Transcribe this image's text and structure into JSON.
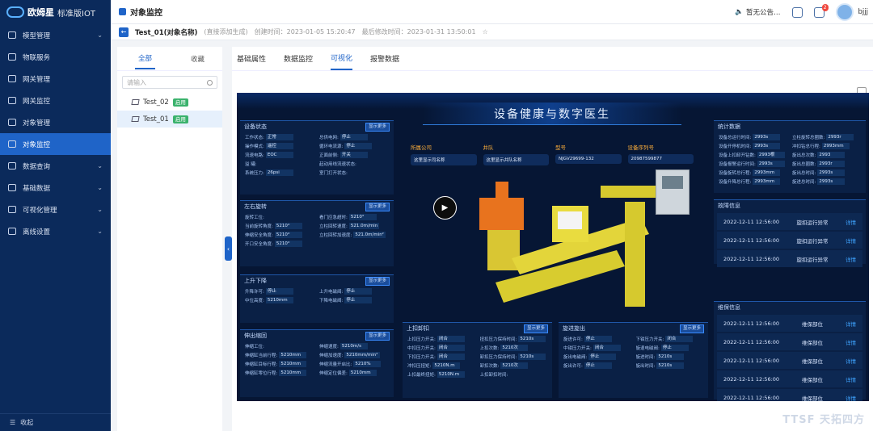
{
  "app": {
    "brand": "欧姆星",
    "edition": "标准版IOT"
  },
  "sidebar": {
    "items": [
      {
        "label": "模型管理",
        "chevron": true
      },
      {
        "label": "物联服务",
        "chevron": false
      },
      {
        "label": "网关管理",
        "chevron": false
      },
      {
        "label": "网关监控",
        "chevron": false
      },
      {
        "label": "对象管理",
        "chevron": false
      },
      {
        "label": "对象监控",
        "chevron": false,
        "active": true
      },
      {
        "label": "数据查询",
        "chevron": true
      },
      {
        "label": "基础数据",
        "chevron": true
      },
      {
        "label": "可视化管理",
        "chevron": true
      },
      {
        "label": "离线设置",
        "chevron": true
      }
    ],
    "collapse_label": "收起"
  },
  "header": {
    "title": "对象监控",
    "notice": "暂无公告…",
    "notif_count": "2",
    "user": "bjjj"
  },
  "subbar": {
    "object": "Test_01(对象名称)",
    "note": "(直接添加生成)",
    "created": "创建时间：2023-01-05 15:20:47",
    "modified": "最后修改时间：2023-01-31 13:50:01"
  },
  "left": {
    "tabs": [
      "全部",
      "收藏"
    ],
    "search_placeholder": "请输入",
    "items": [
      {
        "name": "Test_02",
        "tag": "启用"
      },
      {
        "name": "Test_01",
        "tag": "启用",
        "selected": true
      }
    ]
  },
  "main": {
    "tabs": [
      "基础属性",
      "数据监控",
      "可视化",
      "报警数据"
    ],
    "active_tab": "可视化"
  },
  "dashboard": {
    "title": "设备健康与数字医生",
    "more": "显示更多",
    "device_status": {
      "title": "设备状态",
      "kv": [
        [
          "工作状态:",
          "正常"
        ],
        [
          "总供电网:",
          "停止"
        ],
        [
          "操作模式:",
          "遥控"
        ],
        [
          "循环电流源:",
          "停止"
        ],
        [
          "流速电路:",
          "EOC"
        ],
        [
          "正面前侧:",
          "开关"
        ],
        [
          "溢 罐:",
          ""
        ],
        [
          "起动用线流速状态:",
          ""
        ],
        [
          "系统压力:",
          "26psi"
        ],
        [
          "室门打开状态:",
          ""
        ]
      ]
    },
    "left_rot": {
      "title": "左右旋转",
      "kv": [
        [
          "旋转工位:",
          ""
        ],
        [
          "看门应急超时:",
          "5210°"
        ],
        [
          "当前旋转角度:",
          "5210°"
        ],
        [
          "立柱回转速度:",
          "521.0m/min"
        ],
        [
          "伸缩安全角度:",
          "5210°"
        ],
        [
          "立柱回转加速度:",
          "521.0m/min²"
        ],
        [
          "开口安全角度:",
          "5210°"
        ],
        [
          "",
          ""
        ]
      ]
    },
    "lift": {
      "title": "上升下降",
      "kv": [
        [
          "升降许可:",
          "停止"
        ],
        [
          "上升电磁阀:",
          "停止"
        ],
        [
          "中位高度:",
          "5210mm"
        ],
        [
          "下降电磁阀:",
          "停止"
        ]
      ]
    },
    "extend": {
      "title": "伸出缩回",
      "kv": [
        [
          "伸缩工位:",
          ""
        ],
        [
          "伸缩速度:",
          "5210m/s"
        ],
        [
          "伸缩缸当前行程:",
          "5210mm"
        ],
        [
          "伸缩加速度:",
          "5210mm/min²"
        ],
        [
          "伸缩缸目标行程:",
          "5210mm"
        ],
        [
          "伸缩流量开启比:",
          "5210%"
        ],
        [
          "伸缩缸零位行程:",
          "5210mm"
        ],
        [
          "伸缩定位偏差:",
          "5210mm"
        ]
      ]
    },
    "cards": [
      {
        "title": "所属公司",
        "value": "这里显示司名称"
      },
      {
        "title": "井队",
        "value": "这里显示井队名称"
      },
      {
        "title": "型号",
        "value": "NJGV29699-132"
      },
      {
        "title": "设备序列号",
        "value": "20987599877"
      }
    ],
    "clamp": {
      "title": "上扣卸扣",
      "kv": [
        [
          "上扣压力开关:",
          "闭合"
        ],
        [
          "扭扣压力保持时间:",
          "5210s"
        ],
        [
          "中扣压力开关:",
          "闭合"
        ],
        [
          "上扣次数:",
          "5210次"
        ],
        [
          "下扣压力开关:",
          "闭合"
        ],
        [
          "卸扣压力保持时间:",
          "5210s"
        ],
        [
          "冲扣压扭矩:",
          "5210N.m"
        ],
        [
          "卸扣次数:",
          "5210次"
        ],
        [
          "上扣最终扭矩:",
          "5210N.m"
        ],
        [
          "上扣卸扣时间:",
          ""
        ]
      ]
    },
    "spin": {
      "title": "旋进旋出",
      "kv": [
        [
          "旋进许可:",
          "停止"
        ],
        [
          "下钳压力开关:",
          "闭合"
        ],
        [
          "中钳压力开关:",
          "闭合"
        ],
        [
          "旋退电磁阀:",
          "停止"
        ],
        [
          "旋出电磁阀:",
          "停止"
        ],
        [
          "旋进时间:",
          "5210s"
        ],
        [
          "旋出许可:",
          "停止"
        ],
        [
          "旋出时间:",
          "5210s"
        ]
      ]
    },
    "stats": {
      "title": "统计数据",
      "kv": [
        [
          "设备总运行时间:",
          "2993s"
        ],
        [
          "立柱旋转总圈数:",
          "2993r"
        ],
        [
          "设备开停机时间:",
          "2993s"
        ],
        [
          "冲扣钻总行程:",
          "2993mm"
        ],
        [
          "设备上扣卸开钻数:",
          "2993根"
        ],
        [
          "旋出总次数:",
          "2993"
        ],
        [
          "设备报警运行时间:",
          "2993s"
        ],
        [
          "旋出总圈数:",
          "2993r"
        ],
        [
          "设备旋转总行程:",
          "2993mm"
        ],
        [
          "旋出总时间:",
          "2993s"
        ],
        [
          "设备升降总行程:",
          "2993mm"
        ],
        [
          "旋进总时间:",
          "2993s"
        ]
      ]
    },
    "faults": {
      "title": "故障信息",
      "rows": [
        {
          "time": "2022-12-11 12:56:00",
          "msg": "旋扣运行异常",
          "link": "详情"
        },
        {
          "time": "2022-12-11 12:56:00",
          "msg": "旋扣运行异常",
          "link": "详情"
        },
        {
          "time": "2022-12-11 12:56:00",
          "msg": "旋扣运行异常",
          "link": "详情"
        }
      ]
    },
    "maint": {
      "title": "维保信息",
      "rows": [
        {
          "time": "2022-12-11 12:56:00",
          "msg": "维保部位",
          "link": "详情"
        },
        {
          "time": "2022-12-11 12:56:00",
          "msg": "维保部位",
          "link": "详情"
        },
        {
          "time": "2022-12-11 12:56:00",
          "msg": "维保部位",
          "link": "详情"
        },
        {
          "time": "2022-12-11 12:56:00",
          "msg": "维保部位",
          "link": "详情"
        },
        {
          "time": "2022-12-11 12:56:00",
          "msg": "维保部位",
          "link": "详情"
        }
      ]
    }
  },
  "watermark": "TTSF 天拓四方"
}
